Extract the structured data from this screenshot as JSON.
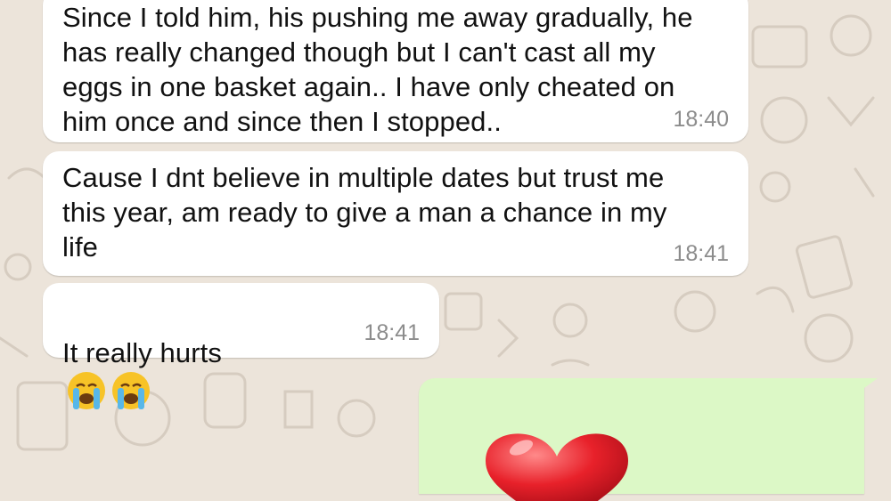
{
  "messages": [
    {
      "direction": "incoming",
      "text": "Since I told him, his pushing me away gradually, he\nhas really changed though but I can't cast all my\neggs in one basket again.. I have only cheated on\nhim once and since then I stopped..",
      "time": "18:40"
    },
    {
      "direction": "incoming",
      "text": "Cause I dnt believe in multiple dates but trust me\nthis year, am ready to give a man a chance in my\nlife",
      "time": "18:41"
    },
    {
      "direction": "incoming",
      "text": "It really hurts",
      "emojis": [
        "crying-face-emoji",
        "crying-face-emoji"
      ],
      "time": "18:41"
    },
    {
      "direction": "outgoing",
      "content": "red-heart-emoji"
    }
  ],
  "colors": {
    "wallpaper": "#ece4da",
    "incoming_bubble": "#ffffff",
    "outgoing_bubble": "#dcf8c6",
    "timestamp": "#8c8c8c"
  }
}
